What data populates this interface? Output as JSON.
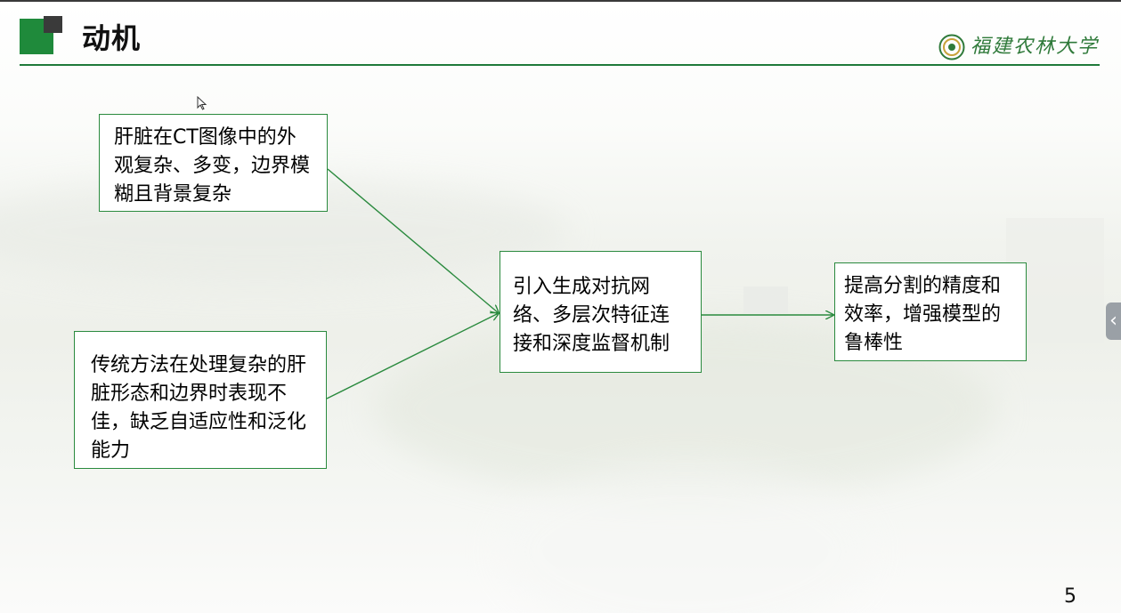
{
  "slide": {
    "title": "动机",
    "university_name": "福建农林大学",
    "page_number": "5"
  },
  "boxes": {
    "problem_appearance": "肝脏在CT图像中的外观复杂、多变，边界模糊且背景复杂",
    "problem_traditional": "传统方法在处理复杂的肝脏形态和边界时表现不佳，缺乏自适应性和泛化能力",
    "method": "引入生成对抗网络、多层次特征连接和深度监督机制",
    "goal": "提高分割的精度和效率，增强模型的鲁棒性"
  },
  "controls": {
    "side_panel_toggle": "‹"
  },
  "colors": {
    "accent_green": "#1f8a3b",
    "box_border": "#2a8a3e",
    "arrow": "#2a8a3e"
  },
  "icons": {
    "cursor": "mouse-pointer-icon",
    "logo": "university-emblem-icon"
  }
}
